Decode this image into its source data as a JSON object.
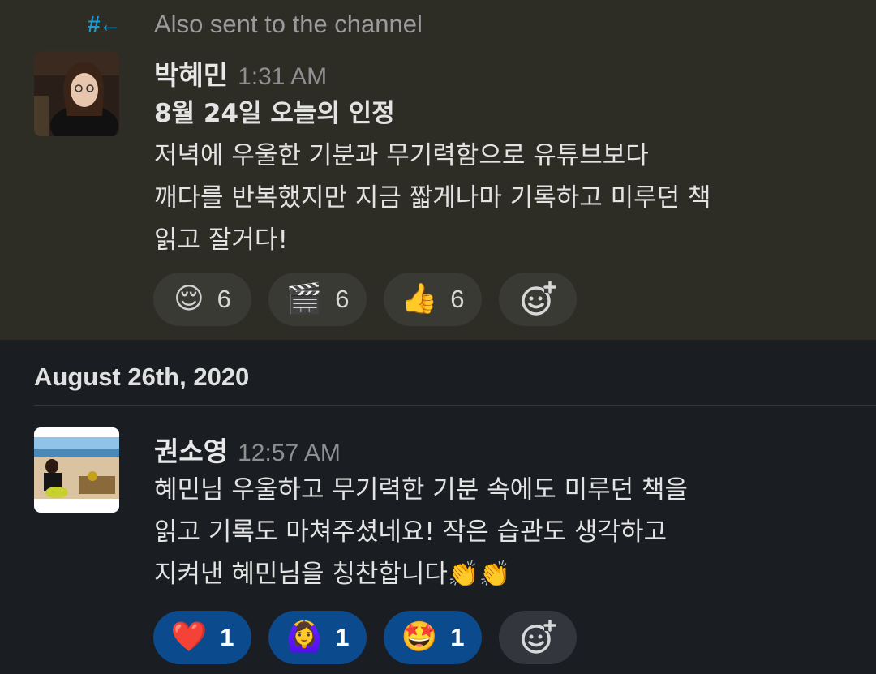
{
  "also_sent": {
    "icon": "hash-arrow-icon",
    "text": "Also sent to the channel"
  },
  "messages": [
    {
      "author": "박혜민",
      "time": "1:31 AM",
      "lines": [
        "8월 24일 오늘의 인정",
        "저녁에 우울한 기분과 무기력함으로 유튜브보다",
        "깨다를 반복했지만 지금 짧게나마 기록하고 미루던 책",
        "읽고 잘거다!"
      ],
      "reactions": [
        {
          "emoji": "😌",
          "count": "6"
        },
        {
          "emoji": "🎬",
          "count": "6"
        },
        {
          "emoji": "👍",
          "count": "6"
        }
      ]
    },
    {
      "author": "권소영",
      "time": "12:57 AM",
      "lines": [
        "혜민님 우울하고 무기력한 기분 속에도 미루던 책을",
        "읽고 기록도 마쳐주셨네요! 작은 습관도 생각하고",
        "지켜낸 혜민님을 칭찬합니다👏👏"
      ],
      "reactions": [
        {
          "emoji": "❤️",
          "count": "1"
        },
        {
          "emoji": "🙆‍♀️",
          "count": "1"
        },
        {
          "emoji": "🤩",
          "count": "1"
        }
      ]
    }
  ],
  "date_divider": "August 26th, 2020",
  "add_reaction_icon": "add-reaction-icon",
  "colors": {
    "highlight_bg": "#2e2d25",
    "bg": "#1a1d21",
    "selected_reaction": "#0b4a8c",
    "channel_icon": "#1d9bd1"
  }
}
